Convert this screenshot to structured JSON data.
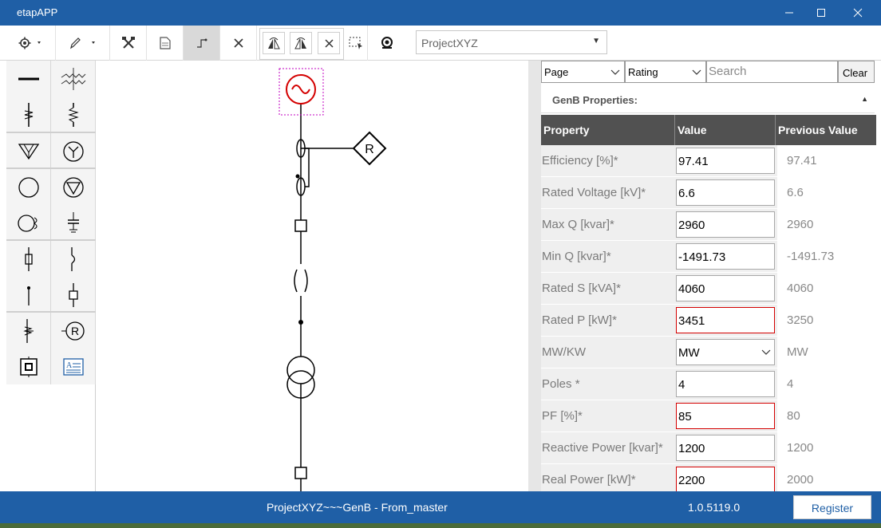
{
  "window": {
    "title": "etapAPP"
  },
  "toolbar": {
    "project": "ProjectXYZ"
  },
  "filters": {
    "page": "Page",
    "rating": "Rating",
    "search_placeholder": "Search",
    "clear_label": "Clear"
  },
  "properties": {
    "section_title": "GenB Properties:",
    "columns": [
      "Property",
      "Value",
      "Previous Value"
    ],
    "rows": [
      {
        "label": "Efficiency [%]*",
        "value": "97.41",
        "previous": "97.41",
        "changed": false
      },
      {
        "label": "Rated Voltage [kV]*",
        "value": "6.6",
        "previous": "6.6",
        "changed": false
      },
      {
        "label": "Max Q [kvar]*",
        "value": "2960",
        "previous": "2960",
        "changed": false
      },
      {
        "label": "Min Q [kvar]*",
        "value": "-1491.73",
        "previous": "-1491.73",
        "changed": false
      },
      {
        "label": "Rated S [kVA]*",
        "value": "4060",
        "previous": "4060",
        "changed": false
      },
      {
        "label": "Rated P [kW]*",
        "value": "3451",
        "previous": "3250",
        "changed": true
      },
      {
        "label": "MW/KW",
        "value": "MW",
        "previous": "MW",
        "changed": false,
        "dropdown": true
      },
      {
        "label": "Poles *",
        "value": "4",
        "previous": "4",
        "changed": false
      },
      {
        "label": "PF [%]*",
        "value": "85",
        "previous": "80",
        "changed": true
      },
      {
        "label": "Reactive Power [kvar]*",
        "value": "1200",
        "previous": "1200",
        "changed": false
      },
      {
        "label": "Real Power [kW]*",
        "value": "2200",
        "previous": "2000",
        "changed": true
      }
    ]
  },
  "diagram": {
    "relay_label": "R"
  },
  "palette": {
    "relay_label": "R",
    "text_label": "A"
  },
  "status": {
    "center": "ProjectXYZ~~~GenB - From_master",
    "version": "1.0.5119.0",
    "register_label": "Register"
  },
  "colors": {
    "accent": "#1f5fa6",
    "selected": "#d40000",
    "header": "#515151"
  }
}
